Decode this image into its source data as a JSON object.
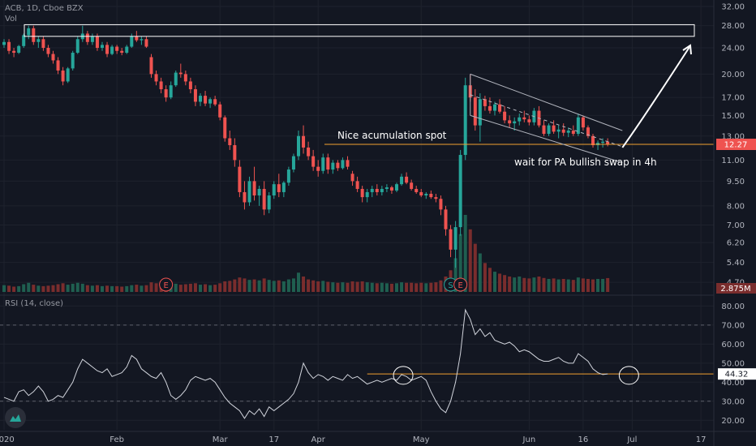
{
  "header": {
    "symbol_line": "ACB, 1D, Cboe BZX",
    "vol_label": "Vol"
  },
  "rsi": {
    "label": "RSI (14, close)",
    "current_badge": "44.32",
    "level_upper": 70,
    "level_lower": 30
  },
  "colors": {
    "background": "#131722",
    "up": "#26a69a",
    "down": "#ef5350",
    "annotation": "#ffffff",
    "support_line": "#f0a030",
    "rsi_line": "#d1d4dc",
    "price_badge": "#ef5350"
  },
  "chart_data": [
    {
      "type": "candlestick",
      "scale": "log",
      "yticks": [
        4.7,
        5.4,
        6.2,
        7.0,
        8.0,
        9.5,
        11.0,
        13.0,
        15.0,
        17.0,
        20.0,
        24.0,
        28.0,
        32.0
      ],
      "ylim": [
        4.6,
        32.0
      ],
      "x_tick_labels": [
        "2020",
        "Feb",
        "Mar",
        "17",
        "Apr",
        "May",
        "Jun",
        "16",
        "Jul",
        "17"
      ],
      "x_tick_day_index": [
        0,
        23,
        44,
        55,
        64,
        85,
        107,
        118,
        128,
        142
      ],
      "last_price_badge": "12.27",
      "last_price": 12.27,
      "candles_ohlc": [
        [
          24.5,
          25.5,
          24.0,
          25.0
        ],
        [
          25.0,
          25.5,
          23.0,
          23.5
        ],
        [
          23.5,
          24.0,
          22.5,
          23.2
        ],
        [
          23.2,
          24.5,
          23.0,
          24.3
        ],
        [
          24.3,
          26.5,
          24.0,
          26.2
        ],
        [
          26.2,
          28.0,
          25.5,
          27.5
        ],
        [
          27.5,
          28.0,
          24.5,
          25.0
        ],
        [
          25.0,
          26.0,
          24.0,
          25.5
        ],
        [
          25.5,
          26.0,
          23.5,
          24.0
        ],
        [
          24.0,
          24.5,
          22.5,
          23.0
        ],
        [
          23.0,
          23.5,
          21.5,
          22.0
        ],
        [
          22.0,
          22.5,
          20.0,
          20.5
        ],
        [
          20.5,
          21.0,
          18.5,
          19.0
        ],
        [
          19.0,
          21.0,
          18.8,
          20.8
        ],
        [
          20.8,
          23.5,
          20.5,
          23.2
        ],
        [
          23.2,
          26.0,
          23.0,
          25.5
        ],
        [
          25.5,
          28.0,
          25.0,
          26.5
        ],
        [
          26.5,
          27.0,
          24.5,
          25.0
        ],
        [
          25.0,
          26.5,
          24.5,
          26.0
        ],
        [
          26.0,
          26.5,
          23.5,
          24.0
        ],
        [
          24.0,
          25.0,
          23.5,
          24.5
        ],
        [
          24.5,
          25.0,
          22.5,
          23.0
        ],
        [
          23.0,
          24.5,
          22.8,
          24.2
        ],
        [
          24.2,
          24.5,
          23.0,
          23.5
        ],
        [
          23.5,
          24.0,
          22.8,
          23.2
        ],
        [
          23.2,
          24.5,
          23.0,
          24.2
        ],
        [
          24.2,
          26.5,
          24.0,
          26.0
        ],
        [
          26.0,
          27.0,
          25.0,
          25.3
        ],
        [
          25.3,
          26.0,
          24.5,
          25.5
        ],
        [
          25.5,
          26.0,
          24.0,
          24.2
        ],
        [
          22.5,
          23.0,
          19.5,
          20.0
        ],
        [
          20.0,
          20.5,
          18.5,
          19.0
        ],
        [
          19.0,
          19.5,
          17.5,
          18.0
        ],
        [
          18.0,
          18.5,
          16.5,
          17.0
        ],
        [
          17.0,
          19.0,
          16.8,
          18.5
        ],
        [
          18.5,
          20.5,
          18.3,
          20.2
        ],
        [
          20.2,
          21.5,
          19.5,
          20.0
        ],
        [
          20.0,
          20.5,
          18.5,
          19.0
        ],
        [
          19.0,
          19.5,
          17.5,
          18.0
        ],
        [
          18.0,
          18.5,
          16.0,
          16.5
        ],
        [
          16.5,
          17.5,
          16.0,
          17.2
        ],
        [
          17.2,
          17.8,
          16.0,
          16.3
        ],
        [
          16.3,
          17.0,
          15.8,
          16.8
        ],
        [
          16.8,
          17.2,
          16.0,
          16.2
        ],
        [
          16.2,
          16.5,
          14.5,
          14.8
        ],
        [
          14.8,
          15.0,
          12.5,
          12.8
        ],
        [
          12.8,
          13.5,
          11.8,
          12.2
        ],
        [
          12.2,
          12.8,
          10.5,
          11.0
        ],
        [
          10.5,
          11.0,
          8.5,
          8.8
        ],
        [
          8.8,
          9.5,
          7.8,
          8.2
        ],
        [
          8.2,
          9.8,
          8.0,
          9.5
        ],
        [
          9.5,
          10.5,
          8.3,
          8.6
        ],
        [
          8.6,
          9.2,
          8.0,
          9.0
        ],
        [
          9.0,
          9.5,
          7.5,
          7.8
        ],
        [
          7.8,
          8.8,
          7.6,
          8.6
        ],
        [
          8.6,
          9.5,
          8.4,
          9.3
        ],
        [
          9.3,
          10.0,
          8.5,
          8.8
        ],
        [
          8.8,
          9.5,
          8.5,
          9.4
        ],
        [
          9.4,
          10.5,
          9.2,
          10.3
        ],
        [
          10.3,
          11.5,
          10.1,
          11.3
        ],
        [
          11.3,
          13.5,
          11.0,
          13.0
        ],
        [
          13.0,
          14.0,
          11.5,
          12.0
        ],
        [
          12.0,
          12.5,
          11.0,
          11.3
        ],
        [
          11.3,
          11.8,
          10.2,
          10.5
        ],
        [
          10.5,
          11.0,
          9.8,
          10.2
        ],
        [
          10.2,
          11.5,
          10.0,
          11.2
        ],
        [
          11.2,
          11.5,
          10.0,
          10.3
        ],
        [
          10.3,
          11.0,
          10.0,
          10.8
        ],
        [
          10.8,
          11.0,
          10.2,
          10.4
        ],
        [
          10.4,
          11.2,
          10.3,
          11.0
        ],
        [
          11.0,
          11.3,
          10.3,
          10.5
        ],
        [
          10.0,
          10.2,
          9.2,
          9.5
        ],
        [
          9.5,
          9.8,
          8.8,
          9.0
        ],
        [
          9.0,
          9.2,
          8.2,
          8.5
        ],
        [
          8.5,
          9.0,
          8.2,
          8.8
        ],
        [
          8.8,
          9.2,
          8.5,
          9.0
        ],
        [
          9.0,
          9.3,
          8.6,
          8.8
        ],
        [
          8.8,
          9.2,
          8.6,
          9.0
        ],
        [
          9.0,
          9.3,
          8.8,
          9.1
        ],
        [
          9.1,
          9.2,
          8.7,
          8.9
        ],
        [
          8.9,
          9.4,
          8.8,
          9.3
        ],
        [
          9.3,
          10.0,
          9.2,
          9.8
        ],
        [
          9.8,
          10.1,
          9.3,
          9.4
        ],
        [
          9.4,
          9.6,
          8.9,
          9.0
        ],
        [
          9.0,
          9.2,
          8.7,
          8.8
        ],
        [
          8.8,
          9.0,
          8.5,
          8.6
        ],
        [
          8.6,
          8.8,
          8.4,
          8.7
        ],
        [
          8.7,
          8.9,
          8.4,
          8.5
        ],
        [
          8.5,
          8.7,
          8.2,
          8.4
        ],
        [
          8.4,
          8.6,
          7.5,
          7.8
        ],
        [
          7.8,
          8.0,
          6.5,
          6.8
        ],
        [
          6.8,
          7.0,
          5.6,
          5.9
        ],
        [
          5.9,
          7.2,
          5.2,
          6.9
        ],
        [
          6.9,
          11.8,
          6.5,
          11.4
        ],
        [
          11.4,
          19.5,
          11.0,
          18.5
        ],
        [
          18.5,
          20.0,
          16.5,
          17.0
        ],
        [
          17.0,
          18.0,
          13.5,
          14.0
        ],
        [
          14.0,
          17.5,
          12.5,
          16.8
        ],
        [
          16.8,
          17.2,
          15.5,
          16.0
        ],
        [
          16.0,
          17.0,
          15.2,
          15.5
        ],
        [
          15.5,
          16.5,
          15.0,
          16.2
        ],
        [
          16.2,
          16.8,
          15.2,
          15.4
        ],
        [
          15.4,
          16.0,
          14.2,
          14.5
        ],
        [
          14.5,
          15.0,
          13.8,
          14.2
        ],
        [
          14.2,
          14.8,
          13.5,
          14.4
        ],
        [
          14.4,
          15.2,
          14.0,
          14.8
        ],
        [
          14.8,
          15.5,
          14.3,
          14.6
        ],
        [
          14.6,
          15.0,
          14.0,
          14.3
        ],
        [
          14.3,
          15.8,
          14.0,
          15.5
        ],
        [
          15.5,
          16.0,
          13.8,
          14.0
        ],
        [
          14.0,
          14.5,
          13.0,
          13.2
        ],
        [
          13.2,
          14.2,
          13.0,
          14.0
        ],
        [
          14.0,
          14.5,
          13.2,
          13.4
        ],
        [
          13.4,
          14.0,
          12.8,
          13.6
        ],
        [
          13.6,
          14.2,
          13.0,
          13.3
        ],
        [
          13.3,
          13.8,
          12.9,
          13.5
        ],
        [
          13.5,
          14.0,
          13.0,
          13.2
        ],
        [
          13.2,
          15.2,
          13.0,
          14.8
        ],
        [
          14.8,
          15.0,
          13.5,
          13.8
        ],
        [
          13.8,
          14.0,
          12.8,
          13.0
        ],
        [
          13.0,
          13.2,
          12.0,
          12.2
        ],
        [
          12.2,
          12.6,
          11.8,
          12.4
        ],
        [
          12.4,
          12.8,
          12.0,
          12.5
        ],
        [
          12.5,
          12.8,
          12.1,
          12.27
        ]
      ],
      "volume_badge": "2.875M",
      "volume_millions": [
        1.4,
        1.3,
        1.1,
        1.2,
        1.6,
        1.9,
        1.5,
        1.3,
        1.2,
        1.3,
        1.4,
        1.6,
        1.8,
        1.5,
        1.7,
        1.9,
        1.7,
        1.4,
        1.3,
        1.4,
        1.2,
        1.3,
        1.2,
        1.2,
        1.1,
        1.2,
        1.4,
        1.5,
        1.3,
        1.4,
        2.0,
        1.8,
        1.9,
        1.8,
        1.6,
        1.7,
        1.5,
        1.6,
        1.7,
        1.8,
        1.5,
        1.6,
        1.4,
        1.5,
        1.8,
        2.2,
        2.3,
        2.6,
        3.0,
        2.8,
        2.5,
        2.6,
        2.4,
        2.8,
        2.5,
        2.3,
        2.4,
        2.2,
        2.6,
        2.8,
        4.0,
        3.2,
        2.6,
        2.4,
        2.2,
        2.3,
        2.1,
        2.0,
        1.9,
        2.0,
        1.9,
        2.2,
        2.1,
        2.2,
        2.0,
        1.9,
        1.8,
        1.9,
        1.8,
        1.7,
        1.8,
        2.0,
        1.9,
        1.9,
        1.8,
        1.9,
        1.8,
        1.9,
        2.0,
        2.4,
        3.2,
        4.5,
        7.0,
        12.0,
        16.0,
        13.0,
        10.0,
        8.0,
        6.0,
        5.0,
        4.2,
        3.8,
        3.5,
        3.2,
        3.0,
        3.2,
        2.9,
        2.8,
        3.0,
        3.2,
        2.9,
        2.7,
        2.8,
        2.6,
        2.7,
        2.6,
        2.5,
        3.0,
        2.8,
        2.7,
        2.6,
        2.7,
        2.7,
        2.875
      ],
      "annotations": [
        {
          "text": "Nice acumulation spot"
        },
        {
          "text": "wait for PA bullish swap in 4h"
        }
      ],
      "horizontal_level": 12.27,
      "resistance_zone": [
        26.0,
        28.2
      ],
      "channel_upper": [
        [
          95,
          20.0
        ],
        [
          126,
          13.5
        ]
      ],
      "channel_lower": [
        [
          95,
          15.0
        ],
        [
          126,
          10.8
        ]
      ],
      "earnings_markers": [
        {
          "label": "E",
          "day_index": 33
        },
        {
          "label": "S",
          "day_index": 91
        },
        {
          "label": "E",
          "day_index": 93
        }
      ]
    },
    {
      "type": "line",
      "name": "RSI (14, close)",
      "yticks": [
        20.0,
        30.0,
        40.0,
        50.0,
        60.0,
        70.0,
        80.0
      ],
      "ylim": [
        15.0,
        84.0
      ],
      "bands": [
        30.0,
        70.0
      ],
      "horizontal_level": 44.32,
      "values": [
        32,
        31,
        30,
        35,
        36,
        33,
        35,
        38,
        35,
        30,
        31,
        33,
        32,
        36,
        40,
        47,
        52,
        50,
        48,
        46,
        45,
        47,
        43,
        44,
        45,
        48,
        54,
        52,
        47,
        45,
        43,
        42,
        45,
        40,
        33,
        31,
        33,
        36,
        41,
        43,
        42,
        41,
        42,
        40,
        36,
        32,
        29,
        27,
        25,
        21,
        25,
        23,
        26,
        22,
        27,
        25,
        27,
        29,
        31,
        34,
        40,
        50,
        45,
        42,
        44,
        43,
        41,
        43,
        42,
        41,
        44,
        42,
        43,
        41,
        39,
        40,
        41,
        40,
        41,
        42,
        41,
        44,
        43,
        41,
        42,
        43,
        41,
        35,
        30,
        26,
        24,
        30,
        40,
        55,
        78,
        73,
        65,
        68,
        64,
        66,
        62,
        61,
        60,
        61,
        59,
        56,
        57,
        56,
        54,
        52,
        51,
        51,
        52,
        53,
        51,
        50,
        50,
        55,
        53,
        51,
        47,
        45,
        44,
        44.32
      ],
      "circles": [
        {
          "day_index": 81,
          "value": 44
        },
        {
          "day_index": 127,
          "value": 44
        }
      ]
    }
  ]
}
